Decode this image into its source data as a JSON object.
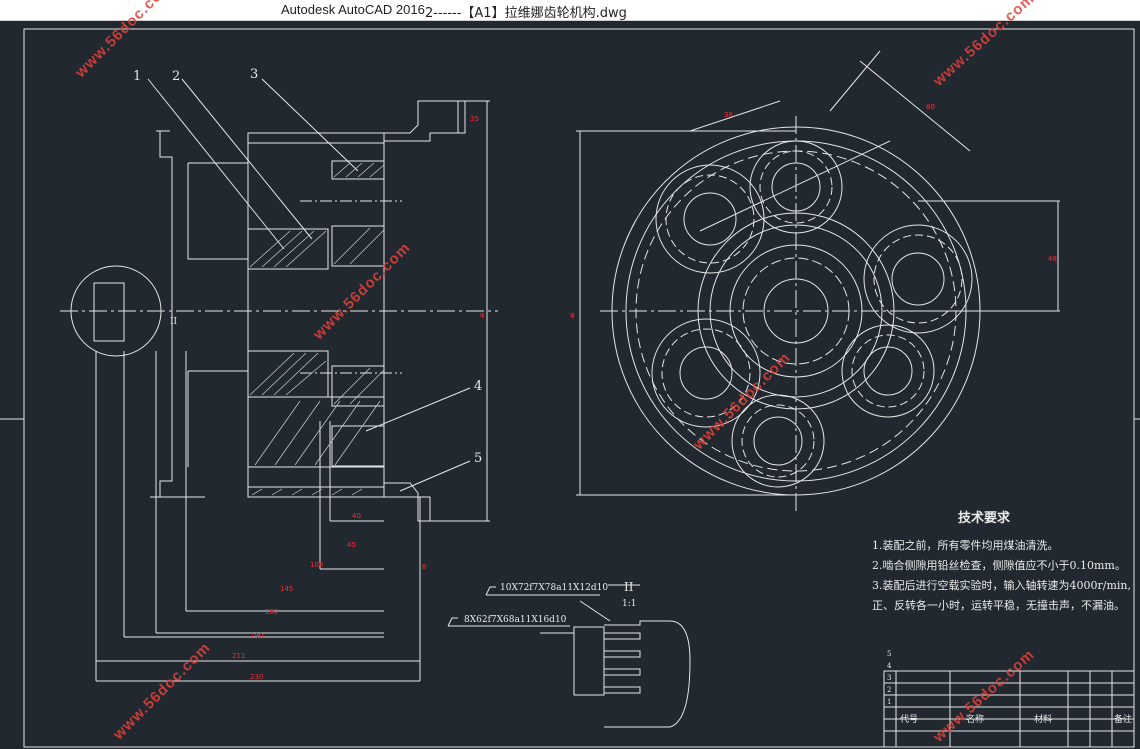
{
  "window": {
    "app_title": "Autodesk AutoCAD 2016",
    "file_title": "2------【A1】拉维娜齿轮机构.dwg"
  },
  "drawing": {
    "callouts": [
      "1",
      "2",
      "3",
      "4",
      "5"
    ],
    "section_marker": "II",
    "detail": {
      "label": "II",
      "scale": "1:1",
      "spline_spec_1": "10X72f7X78a11X12d10",
      "spline_spec_2": "8X62f7X68a11X16d10"
    },
    "technical_requirements": {
      "title": "技术要求",
      "items": [
        "1.装配之前，所有零件均用煤油清洗。",
        "2.啮合侧隙用铅丝检查，侧隙值应不小于0.10mm。",
        "3.装配后进行空载实验时，输入轴转速为4000r/min,",
        "正、反转各一小时，运转平稳，无撞击声，不漏油。"
      ]
    },
    "title_block": {
      "headers": [
        "代号",
        "名称",
        "材料",
        "备注"
      ],
      "row_numbers": [
        "5",
        "4",
        "3",
        "2",
        "1"
      ]
    }
  },
  "watermark": {
    "text": "www.56doc.com"
  }
}
